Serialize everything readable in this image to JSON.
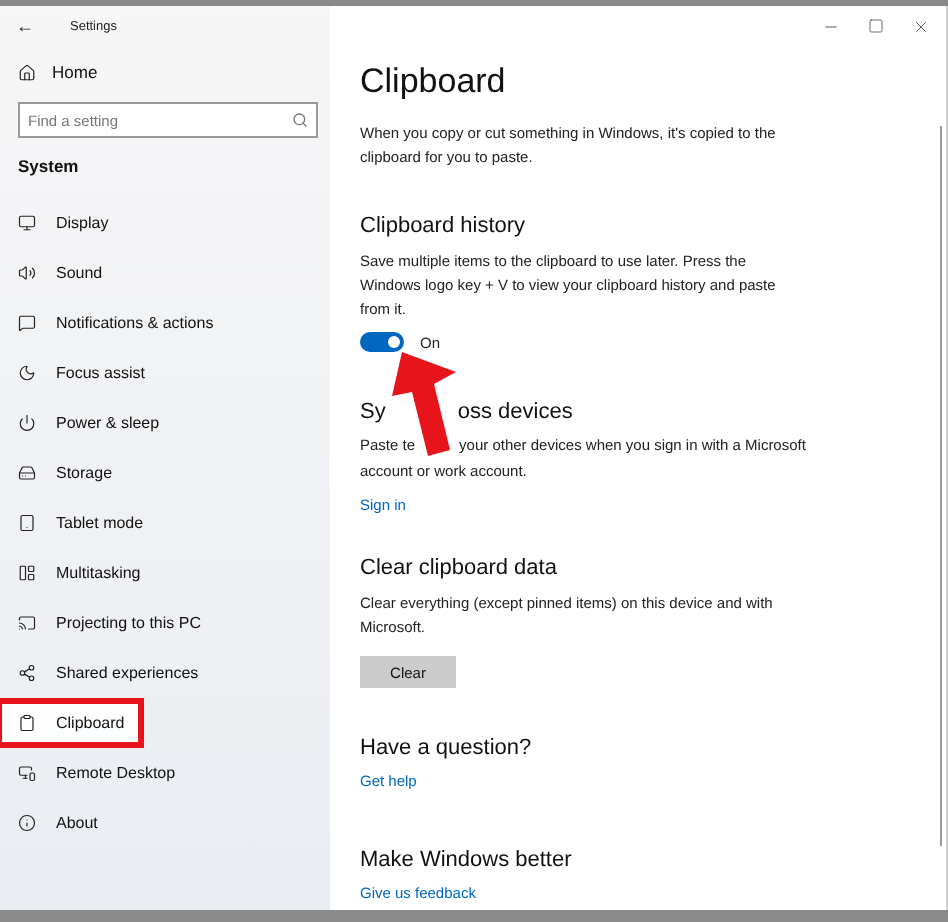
{
  "window": {
    "title": "Settings",
    "back": "←"
  },
  "sidebar": {
    "home": "Home",
    "search": {
      "placeholder": "Find a setting"
    },
    "section": "System",
    "items": [
      {
        "label": "Display",
        "selected": false,
        "highlighted": false
      },
      {
        "label": "Sound",
        "selected": false,
        "highlighted": false
      },
      {
        "label": "Notifications & actions",
        "selected": false,
        "highlighted": false
      },
      {
        "label": "Focus assist",
        "selected": false,
        "highlighted": false
      },
      {
        "label": "Power & sleep",
        "selected": false,
        "highlighted": false
      },
      {
        "label": "Storage",
        "selected": false,
        "highlighted": false
      },
      {
        "label": "Tablet mode",
        "selected": false,
        "highlighted": false
      },
      {
        "label": "Multitasking",
        "selected": false,
        "highlighted": false
      },
      {
        "label": "Projecting to this PC",
        "selected": false,
        "highlighted": false
      },
      {
        "label": "Shared experiences",
        "selected": false,
        "highlighted": false
      },
      {
        "label": "Clipboard",
        "selected": true,
        "highlighted": true
      },
      {
        "label": "Remote Desktop",
        "selected": false,
        "highlighted": false
      },
      {
        "label": "About",
        "selected": false,
        "highlighted": false
      }
    ]
  },
  "page": {
    "title": "Clipboard",
    "intro": "When you copy or cut something in Windows, it's copied to the clipboard for you to paste.",
    "history": {
      "heading": "Clipboard history",
      "text": "Save multiple items to the clipboard to use later. Press the Windows logo key + V to view your clipboard history and paste from it.",
      "toggle": {
        "on": true,
        "label": "On"
      }
    },
    "sync": {
      "heading_parts": [
        "Sy",
        "oss devices"
      ],
      "text_start": "Paste te",
      "text_rest": "your other devices when you sign in with a Microsoft",
      "text_end": "account or work account.",
      "link": "Sign in"
    },
    "clear": {
      "heading": "Clear clipboard data",
      "text": "Clear everything (except pinned items) on this device and with Microsoft.",
      "button": "Clear"
    },
    "question": {
      "heading": "Have a question?",
      "link": "Get help"
    },
    "better": {
      "heading": "Make Windows better",
      "link": "Give us feedback"
    }
  },
  "annotation": {
    "arrow": true
  }
}
